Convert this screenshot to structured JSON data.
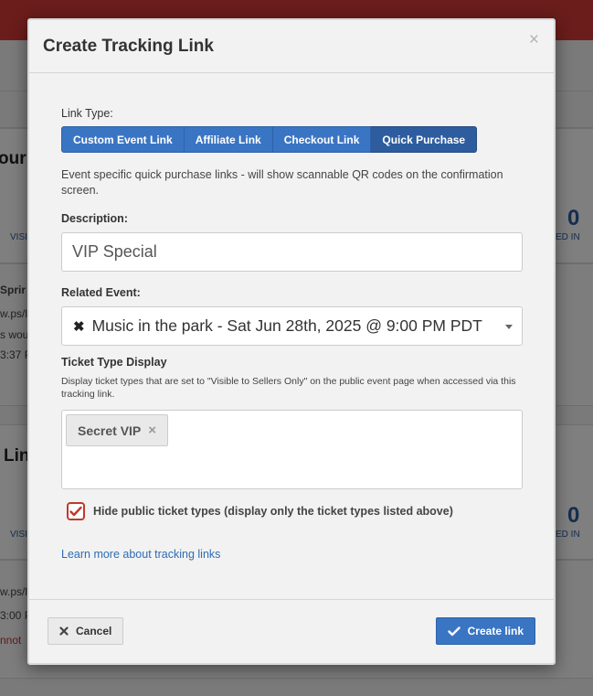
{
  "background": {
    "partial_texts": [
      "our",
      "VISI",
      "Sprir",
      "w.ps/l",
      "s wou",
      "3:37 P",
      "Lin",
      "VISI",
      "w.ps/l",
      "3:00 P",
      "nnot"
    ],
    "counts": [
      "0",
      "0"
    ],
    "count_labels": [
      "ED IN",
      "ED IN"
    ]
  },
  "modal": {
    "title": "Create Tracking Link",
    "close_glyph": "×",
    "link_type_label": "Link Type:",
    "link_types": [
      {
        "label": "Custom Event Link",
        "active": false
      },
      {
        "label": "Affiliate Link",
        "active": false
      },
      {
        "label": "Checkout Link",
        "active": false
      },
      {
        "label": "Quick Purchase",
        "active": true
      }
    ],
    "link_type_help": "Event specific quick purchase links - will show scannable QR codes on the confirmation screen.",
    "description_label": "Description:",
    "description_value": "VIP Special",
    "related_event_label": "Related Event:",
    "related_event_value": "Music in the park - Sat Jun 28th, 2025 @ 9:00 PM PDT",
    "ticket_type_display_label": "Ticket Type Display",
    "ticket_type_help": "Display ticket types that are set to \"Visible to Sellers Only\" on the public event page when accessed via this tracking link.",
    "ticket_tags": [
      "Secret VIP"
    ],
    "tag_remove_glyph": "×",
    "hide_public_label": "Hide public ticket types (display only the ticket types listed above)",
    "hide_public_checked": true,
    "learn_more_link": "Learn more about tracking links",
    "cancel_label": "Cancel",
    "create_label": "Create link"
  },
  "colors": {
    "accent": "#3a75c4",
    "accent_active": "#2d5d9f",
    "check_red": "#c0392b",
    "topbar_red": "#d63b36",
    "link_blue": "#2d6db5"
  },
  "icons": {
    "clear_selection": "x-icon",
    "dropdown": "caret-down-icon",
    "cancel": "x-icon",
    "create": "check-icon"
  }
}
